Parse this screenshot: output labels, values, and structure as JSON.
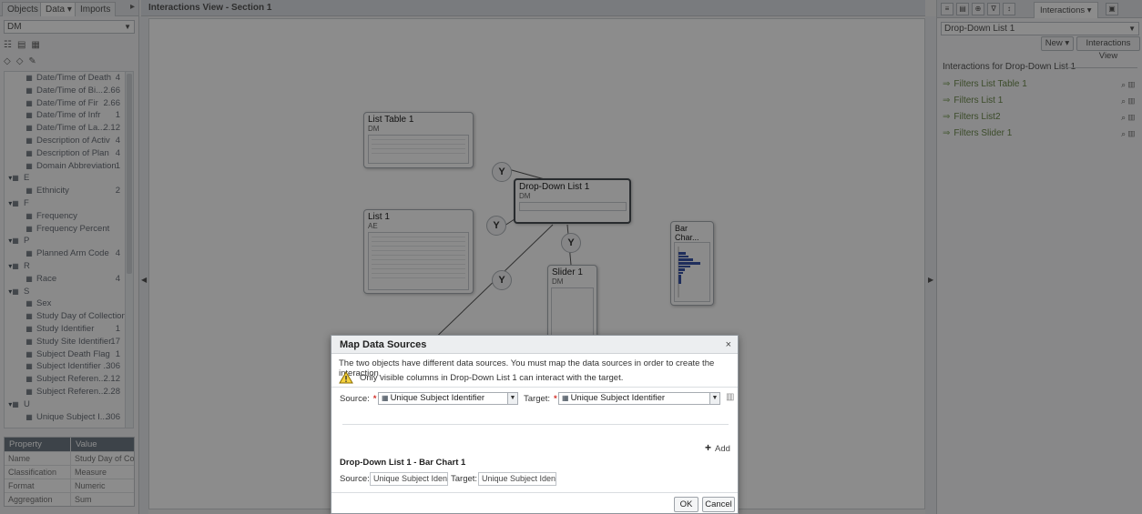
{
  "left_panel": {
    "tabs": [
      "Objects",
      "Data",
      "Imports"
    ],
    "data_source": "DM",
    "tree_items": [
      {
        "label": "Date/Time of Death",
        "count": "4"
      },
      {
        "label": "Date/Time of Bi...",
        "count": "2.66"
      },
      {
        "label": "Date/Time of Fir",
        "count": "2.66"
      },
      {
        "label": "Date/Time of Infr",
        "count": "1"
      },
      {
        "label": "Date/Time of La...",
        "count": "2.12"
      },
      {
        "label": "Description of Activ",
        "count": "4"
      },
      {
        "label": "Description of Plan",
        "count": "4"
      },
      {
        "label": "Domain Abbreviation",
        "count": "1"
      },
      {
        "label": "E",
        "count": "",
        "group": true
      },
      {
        "label": "Ethnicity",
        "count": "2"
      },
      {
        "label": "F",
        "count": "",
        "group": true
      },
      {
        "label": "Frequency",
        "count": ""
      },
      {
        "label": "Frequency Percent",
        "count": ""
      },
      {
        "label": "P",
        "count": "",
        "group": true
      },
      {
        "label": "Planned Arm Code",
        "count": "4"
      },
      {
        "label": "R",
        "count": "",
        "group": true
      },
      {
        "label": "Race",
        "count": "4"
      },
      {
        "label": "S",
        "count": "",
        "group": true
      },
      {
        "label": "Sex",
        "count": ""
      },
      {
        "label": "Study Day of Collection",
        "count": ""
      },
      {
        "label": "Study Identifier",
        "count": "1"
      },
      {
        "label": "Study Site Identifier",
        "count": "17"
      },
      {
        "label": "Subject Death Flag",
        "count": "1"
      },
      {
        "label": "Subject Identifier ...",
        "count": "306"
      },
      {
        "label": "Subject Referen...",
        "count": "2.12"
      },
      {
        "label": "Subject Referen...",
        "count": "2.28"
      },
      {
        "label": "U",
        "count": "",
        "group": true
      },
      {
        "label": "Unique Subject I...",
        "count": "306"
      }
    ],
    "prop_headers": [
      "Property",
      "Value"
    ],
    "prop_rows": [
      [
        "Name",
        "Study Day of Coll"
      ],
      [
        "Classification",
        "Measure"
      ],
      [
        "Format",
        "Numeric"
      ],
      [
        "Aggregation",
        "Sum"
      ]
    ]
  },
  "canvas": {
    "header": "Interactions View - Section 1",
    "objects": {
      "list_table": {
        "title": "List Table 1",
        "sub": "DM"
      },
      "dropdown": {
        "title": "Drop-Down List 1",
        "sub": "DM"
      },
      "list1": {
        "title": "List 1",
        "sub": "AE"
      },
      "slider": {
        "title": "Slider 1",
        "sub": "DM"
      },
      "bar_chart": {
        "title": "Bar Char...",
        "sub": "LB"
      }
    },
    "filter_glyph": "Y"
  },
  "right_panel": {
    "active_tab": "Interactions",
    "object_select": "Drop-Down List 1",
    "new_button": "New",
    "view_button": "Interactions View",
    "section_title": "Interactions for Drop-Down List 1",
    "interactions": [
      "Filters List Table 1",
      "Filters List 1",
      "Filters List2",
      "Filters Slider 1"
    ]
  },
  "dialog": {
    "title": "Map Data Sources",
    "close": "×",
    "info": "The two objects have different data sources. You must map the data sources in order to create the interaction.",
    "warning": "Only visible columns in Drop-Down List 1 can interact with the target.",
    "source_label": "Source:",
    "target_label": "Target:",
    "source_value": "Unique Subject Identifier",
    "target_value": "Unique Subject Identifier",
    "add_label": "Add",
    "pair_title": "Drop-Down List 1 - Bar Chart 1",
    "pair_source_label": "Source:",
    "pair_target_label": "Target:",
    "pair_source_value": "Unique Subject Identifi",
    "pair_target_value": "Unique Subject Identifi",
    "ok": "OK",
    "cancel": "Cancel"
  }
}
